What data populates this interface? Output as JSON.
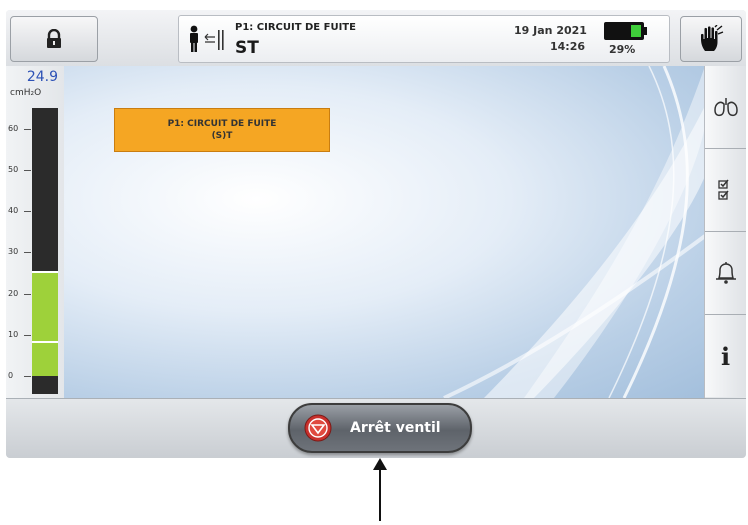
{
  "header": {
    "alarm_title": "P1: CIRCUIT DE FUITE",
    "mode": "ST",
    "date": "19 Jan 2021",
    "time": "14:26",
    "battery_percent_label": "29%",
    "battery_level": 0.29,
    "lock_icon": "lock-icon",
    "hand_icon": "alarm-pause-hand-icon",
    "patient_icon": "patient-circuit-icon"
  },
  "pressure": {
    "value": "24.9",
    "unit": "cmH₂O",
    "ticks": [
      "60",
      "50",
      "40",
      "30",
      "20",
      "10",
      "0"
    ],
    "scale_max": 65,
    "level": 24.9,
    "fill_color": "#9ed13a"
  },
  "alarm_banner": {
    "line1": "P1: CIRCUIT DE FUITE",
    "line2": "(S)T",
    "color": "#f5a623"
  },
  "sidebar": {
    "items": [
      {
        "icon": "lungs-icon"
      },
      {
        "icon": "checklist-icon"
      },
      {
        "icon": "bell-icon"
      },
      {
        "icon": "info-icon",
        "glyph": "i"
      }
    ]
  },
  "footer": {
    "stop_label": "Arrêt ventil",
    "stop_icon": "stop-ventilation-icon"
  }
}
